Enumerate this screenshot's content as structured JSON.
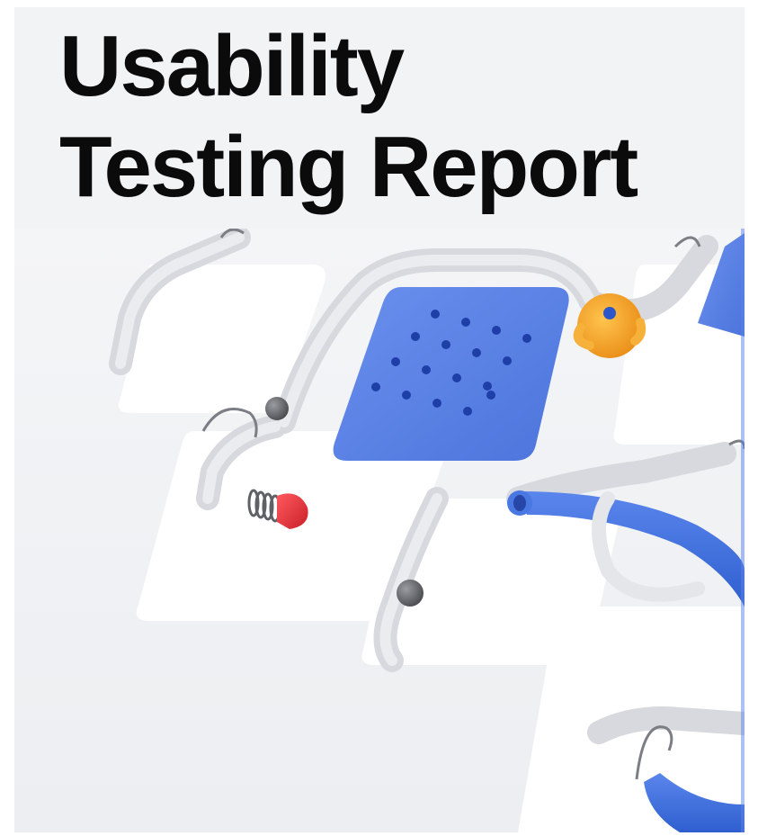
{
  "cover": {
    "title_line_1": "Usability",
    "title_line_2": "Testing Report"
  },
  "illustration": {
    "description_name": "marble-run-illustration",
    "colors": {
      "background": "#f2f3f5",
      "track": "#ffffff",
      "track_groove": "#d9dbe0",
      "blue_tile": "#5b83e6",
      "blue_tube": "#3f6fdc",
      "orange_joint": "#f4a12a",
      "red_capsule": "#e0333a",
      "ball": "#6d6f74"
    }
  }
}
